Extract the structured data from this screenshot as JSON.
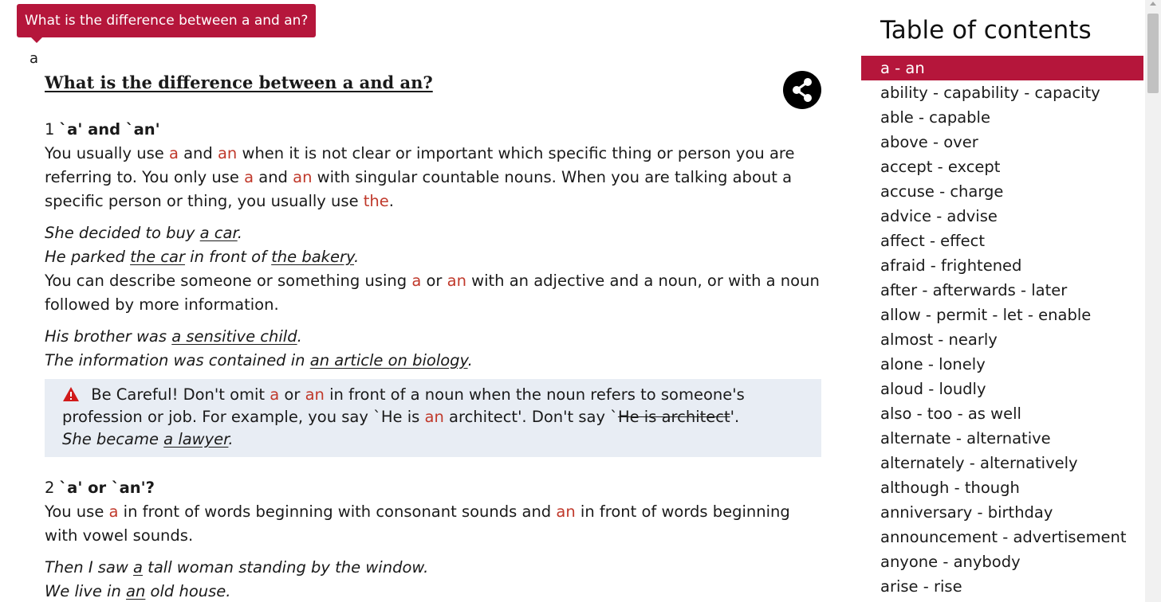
{
  "tooltip": "What is the difference between a and an?",
  "headword": "a",
  "article": {
    "title": "What is the difference between a and an?",
    "share_icon": "share-icon",
    "s1": {
      "num": "1",
      "title": "`a' and `an'",
      "p1": [
        "You usually use ",
        "a",
        " and ",
        "an",
        " when it is not clear or important which specific thing or person you are referring to. You only use ",
        "a",
        " and ",
        "an",
        " with singular countable nouns. When you are talking about a specific person or thing, you usually use ",
        "the",
        "."
      ],
      "ex1": [
        "She decided to buy ",
        "a car",
        "."
      ],
      "ex2": [
        "He parked ",
        "the car",
        " in front of ",
        "the bakery",
        "."
      ],
      "p2": [
        "You can describe someone or something using ",
        "a",
        " or ",
        "an",
        " with an adjective and a noun, or with a noun followed by more information."
      ],
      "ex3": [
        "His brother was ",
        "a sensitive child",
        "."
      ],
      "ex4": [
        "The information was contained in ",
        "an article on biology",
        "."
      ],
      "note": {
        "icon": "warning-icon",
        "text": [
          " Be Careful! Don't omit ",
          "a",
          " or ",
          "an",
          " in front of a noun when the noun refers to someone's profession or job. For example, you say `He is ",
          "an",
          " architect'. Don't say `",
          "He is architect",
          "'."
        ],
        "ex": [
          "She became ",
          "a lawyer",
          "."
        ]
      }
    },
    "s2": {
      "num": "2",
      "title": "`a' or `an'?",
      "p1": [
        "You use ",
        "a",
        " in front of words beginning with consonant sounds and ",
        "an",
        " in front of words beginning with vowel sounds."
      ],
      "ex1": [
        "Then I saw ",
        "a",
        " tall woman standing by the window."
      ],
      "ex2": [
        "We live in ",
        "an",
        " old house."
      ]
    }
  },
  "toc": {
    "title": "Table of contents",
    "items": [
      "a - an",
      "ability - capability - capacity",
      "able - capable",
      "above - over",
      "accept - except",
      "accuse - charge",
      "advice - advise",
      "affect - effect",
      "afraid - frightened",
      "after - afterwards - later",
      "allow - permit - let - enable",
      "almost - nearly",
      "alone - lonely",
      "aloud - loudly",
      "also - too - as well",
      "alternate - alternative",
      "alternately - alternatively",
      "although - though",
      "anniversary - birthday",
      "announcement - advertisement",
      "anyone - anybody",
      "arise - rise"
    ],
    "active_index": 0
  },
  "colors": {
    "brand": "#b5163b",
    "highlight_word": "#c0392b",
    "note_background": "#e8edf4"
  }
}
